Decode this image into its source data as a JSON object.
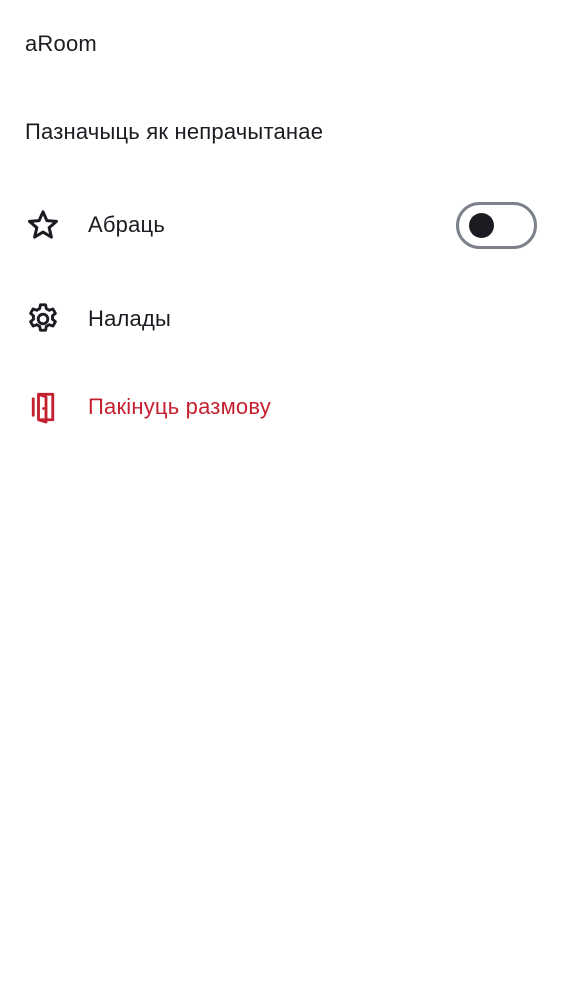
{
  "room": {
    "title": "aRoom"
  },
  "menu": {
    "mark_unread_label": "Пазначыць як непрачытанае",
    "favourite": {
      "label": "Абраць",
      "icon": "star-icon",
      "toggle_on": false
    },
    "settings": {
      "label": "Налады",
      "icon": "gear-icon"
    },
    "leave": {
      "label": "Пакінуць размову",
      "icon": "leave-door-icon"
    }
  },
  "colors": {
    "text": "#1b1b21",
    "danger": "#c4202f",
    "toggle_border": "#7c818b"
  }
}
